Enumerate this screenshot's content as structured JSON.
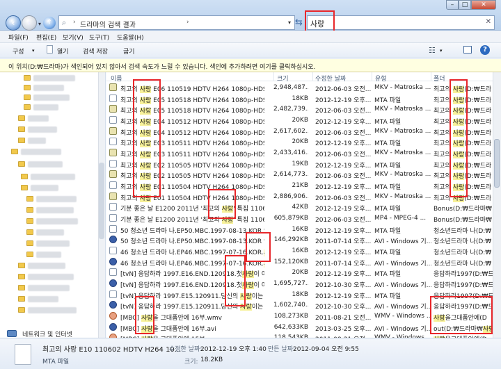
{
  "window": {
    "breadcrumb": [
      "드라마의 검색 결과"
    ],
    "search_query": "사랑",
    "minimize": "–",
    "maximize": "□",
    "close": "✕"
  },
  "menu": {
    "file": "파일(F)",
    "edit": "편집(E)",
    "view": "보기(V)",
    "tools": "도구(T)",
    "help": "도움말(H)"
  },
  "toolbar": {
    "organize": "구성",
    "open": "열기",
    "save_search": "검색 저장",
    "burn": "굽기",
    "help": "?"
  },
  "info_bar": "이 위치(D:₩드라마)가 색인되어 있지 않아서 검색 속도가 느릴 수 있습니다. 색인에 추가하려면 여기를 클릭하십시오.",
  "columns": {
    "name": "이름",
    "size": "크기",
    "date": "수정한 날짜",
    "type": "유형",
    "folder": "폴더"
  },
  "sidebar": {
    "network": "네트워크 및 인터넷"
  },
  "files": [
    {
      "name": "최고의 사랑 E06 110519 HDTV H264 1080p-HDSun...",
      "size": "2,948,487...",
      "date": "2012-06-03 오전...",
      "type": "MKV - Matroska ...",
      "folder": "최고의 사랑(D:₩드라",
      "icon": "mkv"
    },
    {
      "name": "최고의 사랑 E05 110518 HDTV H264 1080p-HDSun...",
      "size": "18KB",
      "date": "2012-12-19 오후...",
      "type": "MTA 파일",
      "folder": "최고의 사랑(D:₩드라",
      "icon": "mta"
    },
    {
      "name": "최고의 사랑 E05 110518 HDTV H264 1080p-HDSun...",
      "size": "2,482,739...",
      "date": "2012-06-03 오전...",
      "type": "MKV - Matroska ...",
      "folder": "최고의 사랑(D:₩드라",
      "icon": "mkv"
    },
    {
      "name": "최고의 사랑 E04 110512 HDTV H264 1080p-HDSun...",
      "size": "20KB",
      "date": "2012-12-19 오후...",
      "type": "MTA 파일",
      "folder": "최고의 사랑(D:₩드라",
      "icon": "mta"
    },
    {
      "name": "최고의 사랑 E04 110512 HDTV H264 1080p-HDSun...",
      "size": "2,617,602...",
      "date": "2012-06-03 오전...",
      "type": "MKV - Matroska ...",
      "folder": "최고의 사랑(D:₩드라",
      "icon": "mkv"
    },
    {
      "name": "최고의 사랑 E03 110511 HDTV H264 1080p-HDSun...",
      "size": "20KB",
      "date": "2012-12-19 오후...",
      "type": "MTA 파일",
      "folder": "최고의 사랑(D:₩드라",
      "icon": "mta"
    },
    {
      "name": "최고의 사랑 E03 110511 HDTV H264 1080p-HDSun...",
      "size": "2,433,416...",
      "date": "2012-06-03 오전...",
      "type": "MKV - Matroska ...",
      "folder": "최고의 사랑(D:₩드라",
      "icon": "mkv"
    },
    {
      "name": "최고의 사랑 E02 110505 HDTV H264 1080p-HDSun...",
      "size": "19KB",
      "date": "2012-12-19 오후...",
      "type": "MTA 파일",
      "folder": "최고의 사랑(D:₩드라",
      "icon": "mta"
    },
    {
      "name": "최고의 사랑 E02 110505 HDTV H264 1080p-HDSun...",
      "size": "2,614,773...",
      "date": "2012-06-03 오전...",
      "type": "MKV - Matroska ...",
      "folder": "최고의 사랑(D:₩드라",
      "icon": "mkv"
    },
    {
      "name": "최고의 사랑 E01 110504 HDTV H264 1080p-HDSun...",
      "size": "21KB",
      "date": "2012-12-19 오후...",
      "type": "MTA 파일",
      "folder": "최고의 사랑(D:₩드라",
      "icon": "mta"
    },
    {
      "name": "최고의 사랑 E01 110504 HDTV H264 1080p-HDSun...",
      "size": "2,886,906...",
      "date": "2012-06-03 오전...",
      "type": "MKV - Matroska ...",
      "folder": "최고의 사랑(D:₩드라",
      "icon": "mkv"
    },
    {
      "name": "기분 좋은 날 E1200 2011년 '최고의 사랑' 특집 11061...",
      "size": "42KB",
      "date": "2012-12-19 오후...",
      "type": "MTA 파일",
      "folder": "Bonus(D:₩드라마₩",
      "icon": "mta"
    },
    {
      "name": "기분 좋은 날 E1200 2011년 '최고의 사랑' 특집 11061...",
      "size": "605,879KB",
      "date": "2012-06-03 오전...",
      "type": "MP4 - MPEG-4 ...",
      "folder": "Bonus(D:₩드라마₩",
      "icon": "mp4"
    },
    {
      "name": "50 청소년 드라마 나.EP50.MBC.1997-08-13.KOR 영화...",
      "size": "16KB",
      "date": "2012-12-19 오후...",
      "type": "MTA 파일",
      "folder": "청소년드라마 나(D:₩",
      "icon": "mta"
    },
    {
      "name": "50 청소년 드라마 나.EP50.MBC.1997-08-13.KOR 영화...",
      "size": "146,292KB",
      "date": "2011-07-14 오후...",
      "type": "AVI - Windows 기...",
      "folder": "청소년드라마 나(D:₩",
      "icon": "avi"
    },
    {
      "name": "46 청소년 드라마 나.EP46.MBC.1997-07-16.KOR.사랑...",
      "size": "16KB",
      "date": "2012-12-19 오후...",
      "type": "MTA 파일",
      "folder": "청소년드라마 나(D:₩",
      "icon": "mta"
    },
    {
      "name": "46 청소년 드라마 나.EP46.MBC.1997-07-16.KOR.사랑...",
      "size": "152,120KB",
      "date": "2011-07-14 오후...",
      "type": "AVI - Windows 기...",
      "folder": "청소년드라마 나(D:₩",
      "icon": "avi"
    },
    {
      "name": "[tvN] 응답하라 1997.E16.END.120918.첫사랑이 이후에...",
      "size": "20KB",
      "date": "2012-12-19 오후...",
      "type": "MTA 파일",
      "folder": "응답하라1997(D:₩드",
      "icon": "mta"
    },
    {
      "name": "[tvN] 응답하라 1997.E16.END.120918.첫사랑이 이후에...",
      "size": "1,695,727...",
      "date": "2012-10-30 오후...",
      "type": "AVI - Windows 기...",
      "folder": "응답하라1997(D:₩드",
      "icon": "avi"
    },
    {
      "name": "[tvN] 응답하라 1997.E15.120911.당신의 사랑이는 이후...",
      "size": "18KB",
      "date": "2012-12-19 오후...",
      "type": "MTA 파일",
      "folder": "응답하라1997(D:₩드",
      "icon": "mta"
    },
    {
      "name": "[tvN] 응답하라 1997.E15.120911.당신의 사랑이는 이후...",
      "size": "1,602,740...",
      "date": "2012-10-30 오후...",
      "type": "AVI - Windows 기...",
      "folder": "응답하라1997(D:₩드",
      "icon": "avi"
    },
    {
      "name": "[MBC] 사랑을 그대품안에 16부.wmv",
      "size": "108,273KB",
      "date": "2011-08-21 오전...",
      "type": "WMV - Windows ...",
      "folder": "사랑을그대품안에(D",
      "icon": "wmv"
    },
    {
      "name": "[MBC] 사랑을 그대품안에 16부.avi",
      "size": "642,633KB",
      "date": "2013-03-25 오후...",
      "type": "AVI - Windows 기...",
      "folder": "out(D:₩드라마₩사랑",
      "icon": "avi"
    },
    {
      "name": "[MBC] 사랑을 그대품안에 15부.wmv",
      "size": "118,543KB",
      "date": "2011-08-21 오전...",
      "type": "WMV - Windows ...",
      "folder": "사랑을그대품안에(D",
      "icon": "wmv"
    }
  ],
  "details": {
    "name": "최고의 사랑 E10 110602 HDTV H264 10...",
    "type": "MTA 파일",
    "modified_label": "수정한 날짜:",
    "modified": "2012-12-19 오후 1:40",
    "size_label": "크기:",
    "size": "18.2KB",
    "created_label": "만든 날짜:",
    "created": "2012-09-04 오전 9:55"
  }
}
